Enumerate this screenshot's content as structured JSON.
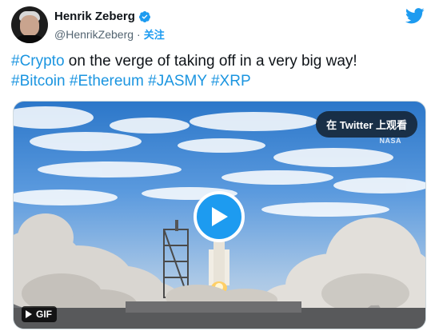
{
  "author": {
    "display_name": "Henrik Zeberg",
    "handle": "@HenrikZeberg",
    "separator": "·",
    "follow_label": "关注"
  },
  "tweet": {
    "segments": [
      {
        "text": "#Crypto",
        "hashtag": true
      },
      {
        "text": " on the verge of taking off in a very big way!",
        "hashtag": false
      },
      {
        "text": "#Bitcoin",
        "hashtag": true
      },
      {
        "text": " ",
        "hashtag": false
      },
      {
        "text": "#Ethereum",
        "hashtag": true
      },
      {
        "text": " ",
        "hashtag": false
      },
      {
        "text": "#JASMY",
        "hashtag": true
      },
      {
        "text": " ",
        "hashtag": false
      },
      {
        "text": "#XRP",
        "hashtag": true
      }
    ]
  },
  "media": {
    "view_on_twitter_label": "在 Twitter 上观看",
    "watermark": "NASA",
    "badge_label": "GIF"
  },
  "colors": {
    "accent": "#1d9bf0",
    "hashtag": "#1b95e0",
    "verified": "#1d9bf0"
  }
}
